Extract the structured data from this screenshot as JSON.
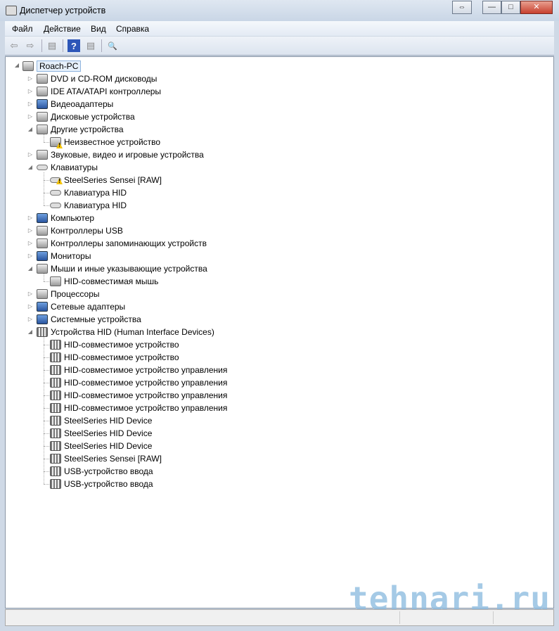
{
  "window": {
    "title": "Диспетчер устройств",
    "buttons": {
      "restore_snap": "⇔",
      "minimize": "—",
      "maximize": "□",
      "close": "✕"
    }
  },
  "menu": [
    "Файл",
    "Действие",
    "Вид",
    "Справка"
  ],
  "toolbar": [
    {
      "icon": "back-arrow-icon",
      "glyph": "⇦"
    },
    {
      "icon": "forward-arrow-icon",
      "glyph": "⇨"
    },
    {
      "icon": "show-hide-console-tree-icon",
      "glyph": "▤"
    },
    {
      "icon": "help-icon",
      "glyph": "?"
    },
    {
      "icon": "show-hide-action-pane-icon",
      "glyph": "▤"
    },
    {
      "icon": "scan-hardware-icon",
      "glyph": "🔍"
    }
  ],
  "tree": {
    "root": "Roach-PC",
    "items": [
      {
        "label": "DVD и CD-ROM дисководы",
        "level": 1,
        "expander": "▷",
        "icon": "gray"
      },
      {
        "label": "IDE ATA/ATAPI контроллеры",
        "level": 1,
        "expander": "▷",
        "icon": "gray"
      },
      {
        "label": "Видеоадаптеры",
        "level": 1,
        "expander": "▷",
        "icon": "blue"
      },
      {
        "label": "Дисковые устройства",
        "level": 1,
        "expander": "▷",
        "icon": "gray"
      },
      {
        "label": "Другие устройства",
        "level": 1,
        "expander": "◢",
        "icon": "gray"
      },
      {
        "label": "Неизвестное устройство",
        "level": 2,
        "icon": "gray warn"
      },
      {
        "label": "Звуковые, видео и игровые устройства",
        "level": 1,
        "expander": "▷",
        "icon": "gray"
      },
      {
        "label": "Клавиатуры",
        "level": 1,
        "expander": "◢",
        "icon": "kbd"
      },
      {
        "label": "SteelSeries Sensei [RAW]",
        "level": 2,
        "icon": "kbd warn"
      },
      {
        "label": "Клавиатура HID",
        "level": 2,
        "icon": "kbd"
      },
      {
        "label": "Клавиатура HID",
        "level": 2,
        "icon": "kbd"
      },
      {
        "label": "Компьютер",
        "level": 1,
        "expander": "▷",
        "icon": "blue"
      },
      {
        "label": "Контроллеры USB",
        "level": 1,
        "expander": "▷",
        "icon": "gray"
      },
      {
        "label": "Контроллеры запоминающих устройств",
        "level": 1,
        "expander": "▷",
        "icon": "gray"
      },
      {
        "label": "Мониторы",
        "level": 1,
        "expander": "▷",
        "icon": "blue"
      },
      {
        "label": "Мыши и иные указывающие устройства",
        "level": 1,
        "expander": "◢",
        "icon": "gray"
      },
      {
        "label": "HID-совместимая мышь",
        "level": 2,
        "icon": "gray"
      },
      {
        "label": "Процессоры",
        "level": 1,
        "expander": "▷",
        "icon": "gray"
      },
      {
        "label": "Сетевые адаптеры",
        "level": 1,
        "expander": "▷",
        "icon": "blue"
      },
      {
        "label": "Системные устройства",
        "level": 1,
        "expander": "▷",
        "icon": "blue"
      },
      {
        "label": "Устройства HID (Human Interface Devices)",
        "level": 1,
        "expander": "◢",
        "icon": "hid"
      },
      {
        "label": "HID-совместимое устройство",
        "level": 2,
        "icon": "hid"
      },
      {
        "label": "HID-совместимое устройство",
        "level": 2,
        "icon": "hid"
      },
      {
        "label": "HID-совместимое устройство управления",
        "level": 2,
        "icon": "hid"
      },
      {
        "label": "HID-совместимое устройство управления",
        "level": 2,
        "icon": "hid"
      },
      {
        "label": "HID-совместимое устройство управления",
        "level": 2,
        "icon": "hid"
      },
      {
        "label": "HID-совместимое устройство управления",
        "level": 2,
        "icon": "hid"
      },
      {
        "label": "SteelSeries HID Device",
        "level": 2,
        "icon": "hid"
      },
      {
        "label": "SteelSeries HID Device",
        "level": 2,
        "icon": "hid"
      },
      {
        "label": "SteelSeries HID Device",
        "level": 2,
        "icon": "hid"
      },
      {
        "label": "SteelSeries Sensei [RAW]",
        "level": 2,
        "icon": "hid"
      },
      {
        "label": "USB-устройство ввода",
        "level": 2,
        "icon": "hid"
      },
      {
        "label": "USB-устройство ввода",
        "level": 2,
        "icon": "hid"
      }
    ]
  },
  "watermark": "tehnari.ru"
}
